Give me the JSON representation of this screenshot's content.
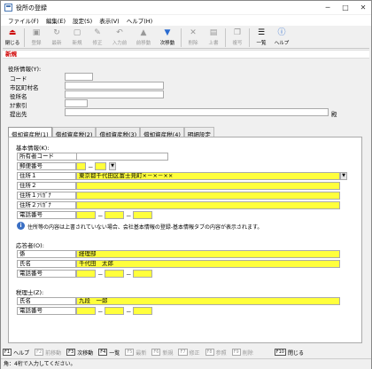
{
  "window": {
    "title": "役所の登録"
  },
  "menu": [
    "ファイル(F)",
    "編集(E)",
    "設定(S)",
    "表示(V)",
    "ヘルプ(H)"
  ],
  "toolbar": [
    {
      "label": "閉じる",
      "icon": "close-door-icon",
      "on": true
    },
    {
      "label": "登録",
      "icon": "save-icon",
      "on": false
    },
    {
      "label": "最新",
      "icon": "refresh-icon",
      "on": false
    },
    {
      "label": "新規",
      "icon": "new-icon",
      "on": false
    },
    {
      "label": "修正",
      "icon": "edit-icon",
      "on": false
    },
    {
      "label": "入力前",
      "icon": "undo-icon",
      "on": false
    },
    {
      "label": "前移動",
      "icon": "arrow-up-icon",
      "on": false
    },
    {
      "label": "次移動",
      "icon": "arrow-down-icon",
      "on": true
    },
    {
      "label": "削除",
      "icon": "delete-icon",
      "on": false
    },
    {
      "label": "上書",
      "icon": "overwrite-icon",
      "on": false
    },
    {
      "label": "複写",
      "icon": "copy-icon",
      "on": false
    },
    {
      "label": "一覧",
      "icon": "list-icon",
      "on": true
    },
    {
      "label": "ヘルプ",
      "icon": "help-icon",
      "on": true
    }
  ],
  "mode": "新規",
  "office": {
    "section": "役所情報(Y):",
    "labels": {
      "code": "コード",
      "city": "市区町村名",
      "name": "役所名",
      "kana": "ｶﾅ索引",
      "submit": "提出先"
    },
    "submit_suffix": "殿"
  },
  "tabs": [
    "償却資産税(1)",
    "償却資産税(2)",
    "償却資産税(3)",
    "償却資産税(4)",
    "明細設定"
  ],
  "basic": {
    "section": "基本情報(K):",
    "labels": {
      "owner_code": "所有者コード",
      "postal": "郵便番号",
      "addr1": "住所１",
      "addr2": "住所２",
      "addr1_kana": "住所１ﾌﾘｶﾞﾅ",
      "addr2_kana": "住所２ﾌﾘｶﾞﾅ",
      "phone": "電話番号"
    },
    "addr1_value": "東京都千代田区富士見町×－×－××",
    "note": "住所等の内容は上書されていない場合、会社基本情報の登録-基本情報タブの内容が表示されます。"
  },
  "respondent": {
    "section": "応答者(O):",
    "labels": {
      "dept": "係",
      "name": "氏名",
      "phone": "電話番号"
    },
    "dept_value": "経理部",
    "name_value": "千代田　太郎"
  },
  "taxacc": {
    "section": "税理士(Z):",
    "labels": {
      "name": "氏名",
      "phone": "電話番号"
    },
    "name_value": "九段　一郎"
  },
  "fkeys": [
    {
      "key": "F1",
      "label": "ヘルプ",
      "on": true
    },
    {
      "key": "F2",
      "label": "前移動",
      "on": false
    },
    {
      "key": "F3",
      "label": "次移動",
      "on": true
    },
    {
      "key": "F4",
      "label": "一覧",
      "on": true
    },
    {
      "key": "F5",
      "label": "最新",
      "on": false
    },
    {
      "key": "F6",
      "label": "新規",
      "on": false
    },
    {
      "key": "F7",
      "label": "修正",
      "on": false
    },
    {
      "key": "F8",
      "label": "参照",
      "on": false
    },
    {
      "key": "F9",
      "label": "削除",
      "on": false
    },
    {
      "key": "F10",
      "label": "閉じる",
      "on": true
    }
  ],
  "status": "角：4桁で入力してください。",
  "separator": "－",
  "dropdown_glyph": "▼"
}
